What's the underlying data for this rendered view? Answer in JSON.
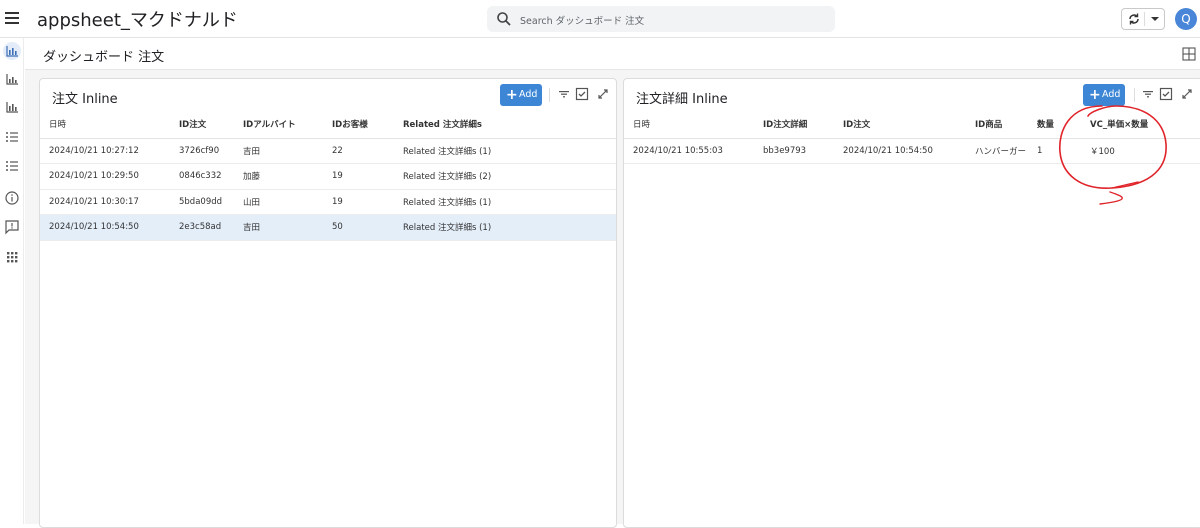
{
  "app": {
    "title": "appsheet_マクドナルド"
  },
  "search": {
    "placeholder": "Search ダッシュボード 注文"
  },
  "user": {
    "avatar_letter": "Q"
  },
  "view": {
    "title": "ダッシュボード 注文"
  },
  "left_panel": {
    "title": "注文 Inline",
    "add_label": "Add",
    "columns": [
      "日時",
      "ID注文",
      "IDアルバイト",
      "IDお客様",
      "Related 注文詳細s"
    ],
    "rows": [
      [
        "2024/10/21 10:27:12",
        "3726cf90",
        "吉田",
        "22",
        "Related 注文詳細s (1)"
      ],
      [
        "2024/10/21 10:29:50",
        "0846c332",
        "加藤",
        "19",
        "Related 注文詳細s (2)"
      ],
      [
        "2024/10/21 10:30:17",
        "5bda09dd",
        "山田",
        "19",
        "Related 注文詳細s (1)"
      ],
      [
        "2024/10/21 10:54:50",
        "2e3c58ad",
        "吉田",
        "50",
        "Related 注文詳細s (1)"
      ]
    ],
    "selected_row": 3
  },
  "right_panel": {
    "title": "注文詳細 Inline",
    "add_label": "Add",
    "columns": [
      "日時",
      "ID注文詳細",
      "ID注文",
      "ID商品",
      "数量",
      "VC_単価×数量"
    ],
    "rows": [
      [
        "2024/10/21 10:55:03",
        "bb3e9793",
        "2024/10/21 10:54:50",
        "ハンバーガー",
        "1",
        "￥100"
      ]
    ]
  },
  "colors": {
    "accent": "#3d86d6",
    "selected_row": "#e4eef9",
    "annotation": "#e0242a"
  }
}
